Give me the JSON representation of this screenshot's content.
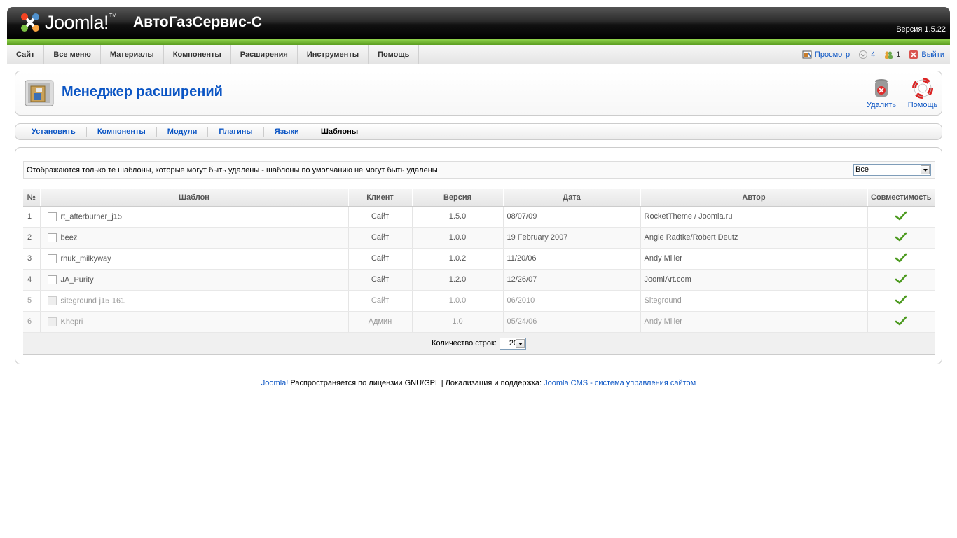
{
  "header": {
    "logo_text": "Joomla!",
    "site_name": "АвтоГазСервис-С",
    "version": "Версия 1.5.22"
  },
  "menu": {
    "items": [
      "Сайт",
      "Все меню",
      "Материалы",
      "Компоненты",
      "Расширения",
      "Инструменты",
      "Помощь"
    ]
  },
  "status": {
    "preview_label": "Просмотр",
    "messages_count": "4",
    "users_count": "1",
    "logout_label": "Выйти"
  },
  "toolbar": {
    "title": "Менеджер расширений",
    "delete_label": "Удалить",
    "help_label": "Помощь"
  },
  "submenu": {
    "items": [
      "Установить",
      "Компоненты",
      "Модули",
      "Плагины",
      "Языки",
      "Шаблоны"
    ],
    "active": "Шаблоны"
  },
  "filter": {
    "text": "Отображаются только те шаблоны, которые могут быть удалены - шаблоны по умолчанию не могут быть удалены",
    "select_value": "Все"
  },
  "table": {
    "columns": [
      "№",
      "Шаблон",
      "Клиент",
      "Версия",
      "Дата",
      "Автор",
      "Совместимость"
    ],
    "rows": [
      {
        "num": "1",
        "name": "rt_afterburner_j15",
        "client": "Сайт",
        "version": "1.5.0",
        "date": "08/07/09",
        "author": "RocketTheme / Joomla.ru",
        "compatible": true
      },
      {
        "num": "2",
        "name": "beez",
        "client": "Сайт",
        "version": "1.0.0",
        "date": "19 February 2007",
        "author": "Angie Radtke/Robert Deutz",
        "compatible": true
      },
      {
        "num": "3",
        "name": "rhuk_milkyway",
        "client": "Сайт",
        "version": "1.0.2",
        "date": "11/20/06",
        "author": "Andy Miller",
        "compatible": true
      },
      {
        "num": "4",
        "name": "JA_Purity",
        "client": "Сайт",
        "version": "1.2.0",
        "date": "12/26/07",
        "author": "JoomlArt.com",
        "compatible": true
      },
      {
        "num": "5",
        "name": "siteground-j15-161",
        "client": "Сайт",
        "version": "1.0.0",
        "date": "06/2010",
        "author": "Siteground",
        "compatible": true
      },
      {
        "num": "6",
        "name": "Khepri",
        "client": "Админ",
        "version": "1.0",
        "date": "05/24/06",
        "author": "Andy Miller",
        "compatible": true
      }
    ]
  },
  "pagination": {
    "label": "Количество строк:",
    "value": "20"
  },
  "footer": {
    "joomla_link": "Joomla!",
    "license_text": " Распространяется по лицензии GNU/GPL | Локализация и поддержка: ",
    "support_link": "Joomla CMS - система управления сайтом"
  }
}
